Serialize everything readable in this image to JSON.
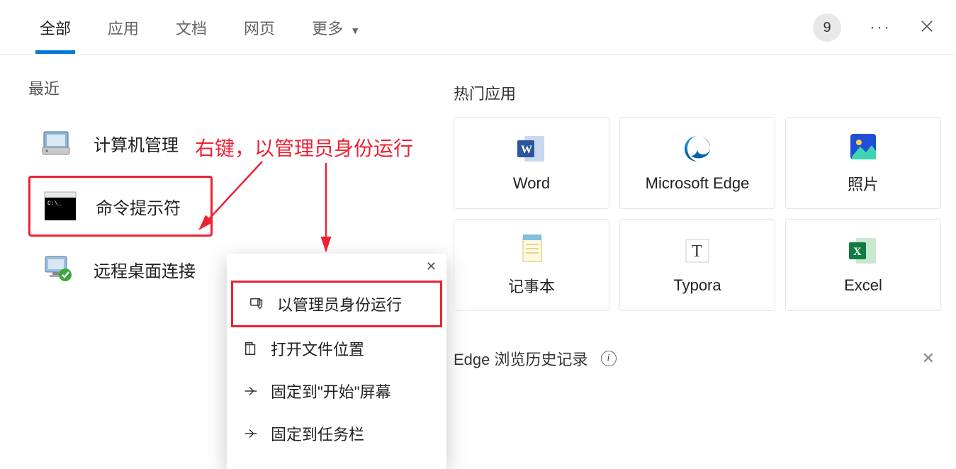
{
  "tabs": {
    "all": "全部",
    "apps": "应用",
    "docs": "文档",
    "web": "网页",
    "more": "更多"
  },
  "top_right": {
    "badge": "9"
  },
  "recent": {
    "label": "最近",
    "items": [
      {
        "label": "计算机管理"
      },
      {
        "label": "命令提示符"
      },
      {
        "label": "远程桌面连接"
      }
    ]
  },
  "context_menu": {
    "items": [
      {
        "label": "以管理员身份运行"
      },
      {
        "label": "打开文件位置"
      },
      {
        "label": "固定到\"开始\"屏幕"
      },
      {
        "label": "固定到任务栏"
      }
    ]
  },
  "popular": {
    "label": "热门应用",
    "apps": [
      {
        "label": "Word"
      },
      {
        "label": "Microsoft Edge"
      },
      {
        "label": "照片"
      },
      {
        "label": "记事本"
      },
      {
        "label": "Typora"
      },
      {
        "label": "Excel"
      }
    ]
  },
  "history": {
    "label": "Edge 浏览历史记录"
  },
  "annotation": {
    "text": "右键，以管理员身份运行"
  }
}
